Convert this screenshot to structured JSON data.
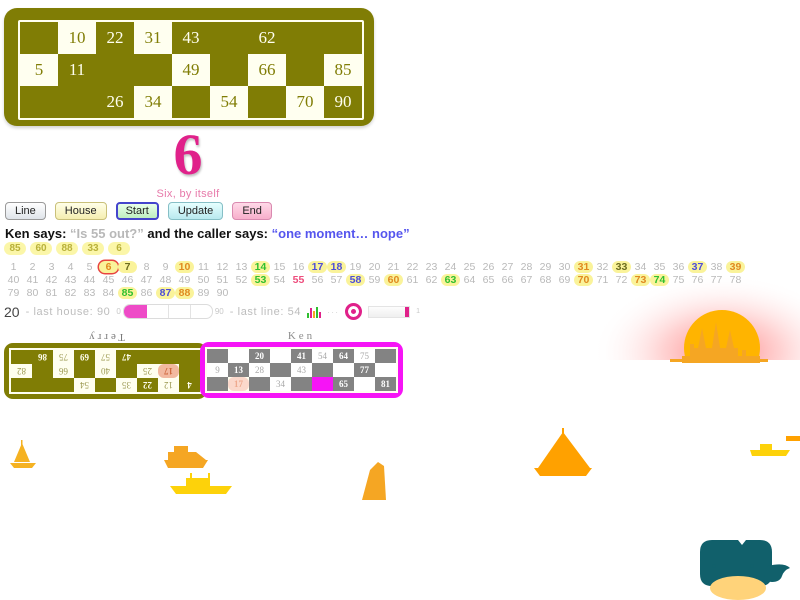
{
  "main_card": {
    "rows": [
      [
        {
          "v": "",
          "s": "blank"
        },
        {
          "v": "10",
          "s": "num-light"
        },
        {
          "v": "22",
          "s": "num-dark"
        },
        {
          "v": "31",
          "s": "num-light"
        },
        {
          "v": "43",
          "s": "num-dark"
        },
        {
          "v": "",
          "s": "blank"
        },
        {
          "v": "62",
          "s": "num-dark"
        },
        {
          "v": "",
          "s": "blank"
        },
        {
          "v": "",
          "s": "blank"
        }
      ],
      [
        {
          "v": "5",
          "s": "num-light"
        },
        {
          "v": "11",
          "s": "num-dark"
        },
        {
          "v": "",
          "s": "blank"
        },
        {
          "v": "",
          "s": "blank"
        },
        {
          "v": "49",
          "s": "num-light"
        },
        {
          "v": "",
          "s": "blank"
        },
        {
          "v": "66",
          "s": "num-light"
        },
        {
          "v": "",
          "s": "blank"
        },
        {
          "v": "85",
          "s": "num-light"
        }
      ],
      [
        {
          "v": "",
          "s": "blank"
        },
        {
          "v": "",
          "s": "blank"
        },
        {
          "v": "26",
          "s": "num-dark"
        },
        {
          "v": "34",
          "s": "num-light"
        },
        {
          "v": "",
          "s": "blank"
        },
        {
          "v": "54",
          "s": "num-light"
        },
        {
          "v": "",
          "s": "blank"
        },
        {
          "v": "70",
          "s": "num-light"
        },
        {
          "v": "90",
          "s": "num-dark"
        }
      ]
    ]
  },
  "call": {
    "number": "6",
    "text": "Six, by itself",
    "color": "#e0218a"
  },
  "buttons": [
    {
      "label": "Line",
      "name": "line-button",
      "cls": "line"
    },
    {
      "label": "House",
      "name": "house-button",
      "cls": "house"
    },
    {
      "label": "Start",
      "name": "start-button",
      "cls": "start"
    },
    {
      "label": "Update",
      "name": "update-button",
      "cls": "update"
    },
    {
      "label": "End",
      "name": "end-button",
      "cls": "end"
    }
  ],
  "caller": {
    "speaker_prefix": "Ken says: ",
    "question": "“Is 55 out?”",
    "middle": " and the caller says: ",
    "reply": "“one moment… nope”"
  },
  "recent_calls": [
    "85",
    "60",
    "88",
    "33",
    "6"
  ],
  "board": {
    "rows": [
      [
        {
          "n": "1",
          "s": ""
        },
        {
          "n": "2",
          "s": ""
        },
        {
          "n": "3",
          "s": ""
        },
        {
          "n": "4",
          "s": ""
        },
        {
          "n": "5",
          "s": ""
        },
        {
          "n": "6",
          "s": "current"
        },
        {
          "n": "7",
          "s": "called"
        },
        {
          "n": "8",
          "s": ""
        },
        {
          "n": "9",
          "s": ""
        },
        {
          "n": "10",
          "s": "called-orange"
        },
        {
          "n": "11",
          "s": ""
        },
        {
          "n": "12",
          "s": ""
        },
        {
          "n": "13",
          "s": ""
        },
        {
          "n": "14",
          "s": "called-green"
        },
        {
          "n": "15",
          "s": ""
        },
        {
          "n": "16",
          "s": ""
        },
        {
          "n": "17",
          "s": "called-blue"
        },
        {
          "n": "18",
          "s": "called-blue"
        },
        {
          "n": "19",
          "s": ""
        },
        {
          "n": "20",
          "s": ""
        },
        {
          "n": "21",
          "s": ""
        },
        {
          "n": "22",
          "s": ""
        },
        {
          "n": "23",
          "s": ""
        },
        {
          "n": "24",
          "s": ""
        },
        {
          "n": "25",
          "s": ""
        },
        {
          "n": "26",
          "s": ""
        },
        {
          "n": "27",
          "s": ""
        },
        {
          "n": "28",
          "s": ""
        },
        {
          "n": "29",
          "s": ""
        },
        {
          "n": "30",
          "s": ""
        },
        {
          "n": "31",
          "s": "called-orange"
        },
        {
          "n": "32",
          "s": ""
        },
        {
          "n": "33",
          "s": "called"
        },
        {
          "n": "34",
          "s": ""
        },
        {
          "n": "35",
          "s": ""
        },
        {
          "n": "36",
          "s": ""
        },
        {
          "n": "37",
          "s": "called-blue"
        },
        {
          "n": "38",
          "s": ""
        },
        {
          "n": "39",
          "s": "called-orange"
        }
      ],
      [
        {
          "n": "40",
          "s": ""
        },
        {
          "n": "41",
          "s": ""
        },
        {
          "n": "42",
          "s": ""
        },
        {
          "n": "43",
          "s": ""
        },
        {
          "n": "44",
          "s": ""
        },
        {
          "n": "45",
          "s": ""
        },
        {
          "n": "46",
          "s": ""
        },
        {
          "n": "47",
          "s": ""
        },
        {
          "n": "48",
          "s": ""
        },
        {
          "n": "49",
          "s": ""
        },
        {
          "n": "50",
          "s": ""
        },
        {
          "n": "51",
          "s": ""
        },
        {
          "n": "52",
          "s": ""
        },
        {
          "n": "53",
          "s": "called-green"
        },
        {
          "n": "54",
          "s": ""
        },
        {
          "n": "55",
          "s": "pinkmark"
        },
        {
          "n": "56",
          "s": ""
        },
        {
          "n": "57",
          "s": ""
        },
        {
          "n": "58",
          "s": "called-blue"
        },
        {
          "n": "59",
          "s": ""
        },
        {
          "n": "60",
          "s": "called-orange"
        },
        {
          "n": "61",
          "s": ""
        },
        {
          "n": "62",
          "s": ""
        },
        {
          "n": "63",
          "s": "called-green"
        },
        {
          "n": "64",
          "s": ""
        },
        {
          "n": "65",
          "s": ""
        },
        {
          "n": "66",
          "s": ""
        },
        {
          "n": "67",
          "s": ""
        },
        {
          "n": "68",
          "s": ""
        },
        {
          "n": "69",
          "s": ""
        },
        {
          "n": "70",
          "s": "called-orange"
        },
        {
          "n": "71",
          "s": ""
        },
        {
          "n": "72",
          "s": ""
        },
        {
          "n": "73",
          "s": "called-orange"
        },
        {
          "n": "74",
          "s": "called-green"
        },
        {
          "n": "75",
          "s": ""
        },
        {
          "n": "76",
          "s": ""
        },
        {
          "n": "77",
          "s": ""
        },
        {
          "n": "78",
          "s": ""
        }
      ],
      [
        {
          "n": "79",
          "s": ""
        },
        {
          "n": "80",
          "s": ""
        },
        {
          "n": "81",
          "s": ""
        },
        {
          "n": "82",
          "s": ""
        },
        {
          "n": "83",
          "s": ""
        },
        {
          "n": "84",
          "s": ""
        },
        {
          "n": "85",
          "s": "called-green"
        },
        {
          "n": "86",
          "s": ""
        },
        {
          "n": "87",
          "s": "called-blue"
        },
        {
          "n": "88",
          "s": "called-orange"
        },
        {
          "n": "89",
          "s": ""
        },
        {
          "n": "90",
          "s": ""
        }
      ]
    ]
  },
  "status": {
    "count": "20",
    "last_house_label": "- last house: 90",
    "slider_min": "0",
    "slider_max": "90",
    "slider_value": 26,
    "last_line_label": "- last line: 54",
    "chart_icon": "bar-chart-icon",
    "dots": "···",
    "donut_icon": "donut-icon",
    "progress_suffix": "1"
  },
  "players": [
    {
      "name": "Terry",
      "rows": [
        [
          {
            "v": "4",
            "s": "on"
          },
          {
            "v": "12",
            "s": "off"
          },
          {
            "v": "22",
            "s": "on"
          },
          {
            "v": "35",
            "s": "off"
          },
          {
            "v": "",
            "s": "blank"
          },
          {
            "v": "54",
            "s": "off"
          },
          {
            "v": "",
            "s": "blank"
          },
          {
            "v": "",
            "s": "blank"
          },
          {
            "v": "",
            "s": "blank"
          }
        ],
        [
          {
            "v": "",
            "s": "blank"
          },
          {
            "v": "17",
            "s": "hit"
          },
          {
            "v": "25",
            "s": "off"
          },
          {
            "v": "",
            "s": "blank"
          },
          {
            "v": "40",
            "s": "off"
          },
          {
            "v": "",
            "s": "blank"
          },
          {
            "v": "66",
            "s": "off"
          },
          {
            "v": "",
            "s": "blank"
          },
          {
            "v": "82",
            "s": "off"
          }
        ],
        [
          {
            "v": "",
            "s": "blank"
          },
          {
            "v": "",
            "s": "blank"
          },
          {
            "v": "",
            "s": "blank"
          },
          {
            "v": "47",
            "s": "on"
          },
          {
            "v": "57",
            "s": "off"
          },
          {
            "v": "69",
            "s": "on"
          },
          {
            "v": "75",
            "s": "off"
          },
          {
            "v": "86",
            "s": "on"
          },
          {
            "v": "",
            "s": "blank"
          }
        ]
      ]
    },
    {
      "name": "Ken",
      "rows": [
        [
          {
            "v": "",
            "s": "blank"
          },
          {
            "v": "",
            "s": "off"
          },
          {
            "v": "20",
            "s": "on"
          },
          {
            "v": "",
            "s": "off"
          },
          {
            "v": "41",
            "s": "on"
          },
          {
            "v": "54",
            "s": "off"
          },
          {
            "v": "64",
            "s": "on"
          },
          {
            "v": "75",
            "s": "off"
          },
          {
            "v": "",
            "s": "blank"
          }
        ],
        [
          {
            "v": "9",
            "s": "off"
          },
          {
            "v": "13",
            "s": "on"
          },
          {
            "v": "28",
            "s": "off"
          },
          {
            "v": "",
            "s": "blank"
          },
          {
            "v": "43",
            "s": "off"
          },
          {
            "v": "",
            "s": "blank"
          },
          {
            "v": "",
            "s": "off"
          },
          {
            "v": "77",
            "s": "on"
          },
          {
            "v": "",
            "s": "off"
          }
        ],
        [
          {
            "v": "",
            "s": "blank"
          },
          {
            "v": "17",
            "s": "hit"
          },
          {
            "v": "",
            "s": "blank"
          },
          {
            "v": "34",
            "s": "off"
          },
          {
            "v": "",
            "s": "blank"
          },
          {
            "v": "",
            "s": "active"
          },
          {
            "v": "65",
            "s": "on"
          },
          {
            "v": "",
            "s": "off"
          },
          {
            "v": "81",
            "s": "on"
          }
        ]
      ]
    }
  ],
  "scene": {
    "sun_color": "#ffb400",
    "sky_color": "#ff9a9a",
    "boat_color": "#f5a623",
    "whale_color": "#11606b",
    "names": [
      "sun",
      "oil-rig",
      "sailboat",
      "cargo-ship",
      "ferry",
      "whale"
    ]
  }
}
